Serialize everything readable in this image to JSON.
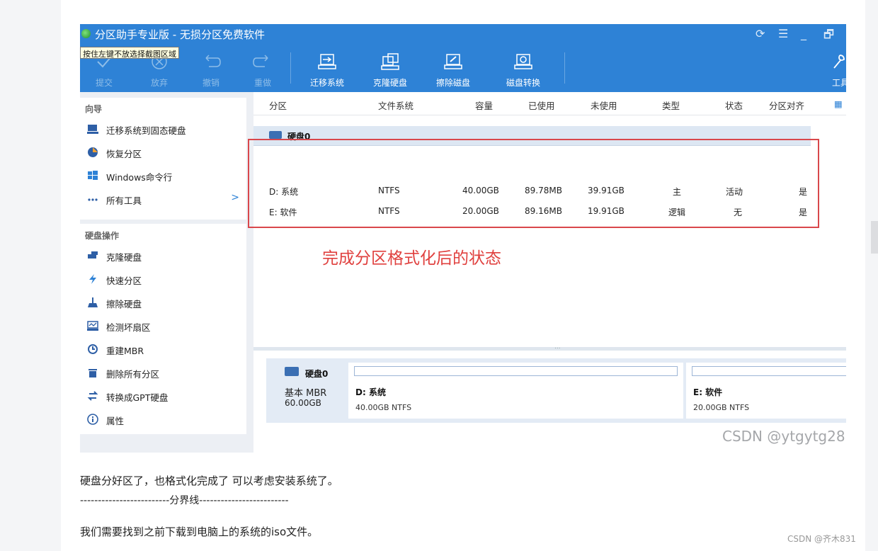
{
  "window": {
    "title": "分区助手专业版 - 无损分区免费软件",
    "tooltip": "按住左键不放选择截图区域"
  },
  "toolbar": {
    "items": [
      {
        "label": "提交",
        "icon": "check-icon"
      },
      {
        "label": "放弃",
        "icon": "cancel-icon"
      },
      {
        "label": "撤销",
        "icon": "undo-icon"
      },
      {
        "label": "重做",
        "icon": "redo-icon"
      },
      {
        "label": "迁移系统",
        "icon": "migrate-os-icon"
      },
      {
        "label": "克隆硬盘",
        "icon": "clone-disk-icon"
      },
      {
        "label": "擦除磁盘",
        "icon": "wipe-disk-icon"
      },
      {
        "label": "磁盘转换",
        "icon": "convert-disk-icon"
      },
      {
        "label": "工具",
        "icon": "tools-icon"
      }
    ]
  },
  "sidebar": {
    "wizard": {
      "heading": "向导",
      "items": [
        {
          "label": "迁移系统到固态硬盘",
          "icon": "migrate-ssd-icon"
        },
        {
          "label": "恢复分区",
          "icon": "recover-partition-icon"
        },
        {
          "label": "Windows命令行",
          "icon": "windows-icon"
        },
        {
          "label": "所有工具",
          "icon": "more-icon",
          "arrow": ">"
        }
      ]
    },
    "disk_ops": {
      "heading": "硬盘操作",
      "items": [
        {
          "label": "克隆硬盘",
          "icon": "clone-disk-icon"
        },
        {
          "label": "快速分区",
          "icon": "lightning-icon"
        },
        {
          "label": "擦除硬盘",
          "icon": "broom-icon"
        },
        {
          "label": "检测坏扇区",
          "icon": "disk-check-icon"
        },
        {
          "label": "重建MBR",
          "icon": "rebuild-icon"
        },
        {
          "label": "删除所有分区",
          "icon": "trash-icon"
        },
        {
          "label": "转换成GPT硬盘",
          "icon": "convert-icon"
        },
        {
          "label": "属性",
          "icon": "info-icon"
        }
      ]
    }
  },
  "table": {
    "columns": [
      "分区",
      "文件系统",
      "容量",
      "已使用",
      "未使用",
      "类型",
      "状态",
      "分区对齐"
    ],
    "disk_label": "硬盘0",
    "rows": [
      {
        "partition": "D: 系统",
        "fs": "NTFS",
        "capacity": "40.00GB",
        "used": "89.78MB",
        "free": "39.91GB",
        "type": "主",
        "status": "活动",
        "aligned": "是"
      },
      {
        "partition": "E: 软件",
        "fs": "NTFS",
        "capacity": "20.00GB",
        "used": "89.16MB",
        "free": "19.91GB",
        "type": "逻辑",
        "status": "无",
        "aligned": "是"
      }
    ]
  },
  "annotation": "完成分区格式化后的状态",
  "disk_panel": {
    "name": "硬盘0",
    "type": "基本 MBR",
    "size": "60.00GB",
    "partitions": [
      {
        "name": "D: 系统",
        "info": "40.00GB NTFS"
      },
      {
        "name": "E: 软件",
        "info": "20.00GB NTFS"
      }
    ]
  },
  "screenshot_watermark": "CSDN @ytgytg28",
  "article": {
    "p1": "硬盘分好区了，也格式化完成了 可以考虑安装系统了。",
    "divider": "-------------------------分界线-------------------------",
    "p2": "我们需要找到之前下载到电脑上的系统的iso文件。"
  },
  "footer_watermark": "CSDN @齐木831",
  "colors": {
    "toolbar_blue": "#2e82d6",
    "annotation_red": "#e0413f",
    "accent_blue": "#3b6fb3"
  }
}
